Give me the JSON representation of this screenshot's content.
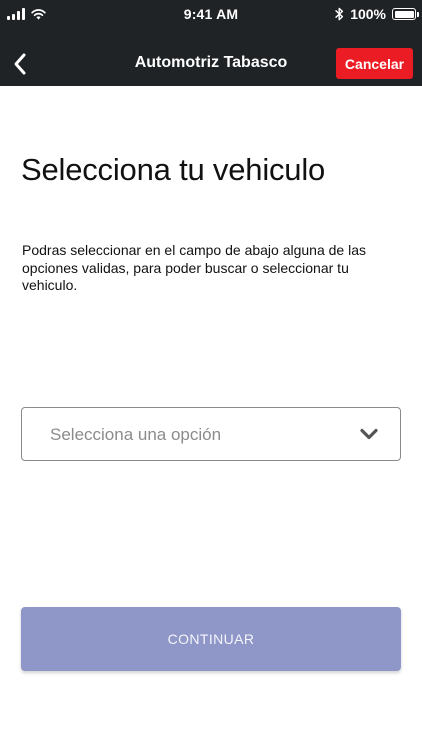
{
  "status_bar": {
    "time": "9:41 AM",
    "battery": "100%",
    "battery_level": 1.0,
    "signal_icon": "cellular-signal-icon",
    "wifi_icon": "wifi-icon",
    "bluetooth_icon": "bluetooth-icon"
  },
  "nav": {
    "back_icon": "chevron-left-icon",
    "title": "Automotriz Tabasco",
    "cancel_label": "Cancelar"
  },
  "main": {
    "title": "Selecciona tu vehiculo",
    "description": "Podras seleccionar en el campo de abajo alguna de las opciones validas, para poder buscar o seleccionar tu vehiculo.",
    "select": {
      "placeholder": "Selecciona una opción",
      "icon": "chevron-down-icon"
    },
    "continue_label": "CONTINUAR"
  },
  "colors": {
    "header_background": "#1f2326",
    "cancel_button": "#ec1c24",
    "continue_button": "#8f96c8",
    "placeholder_text": "#8b8b8b"
  }
}
